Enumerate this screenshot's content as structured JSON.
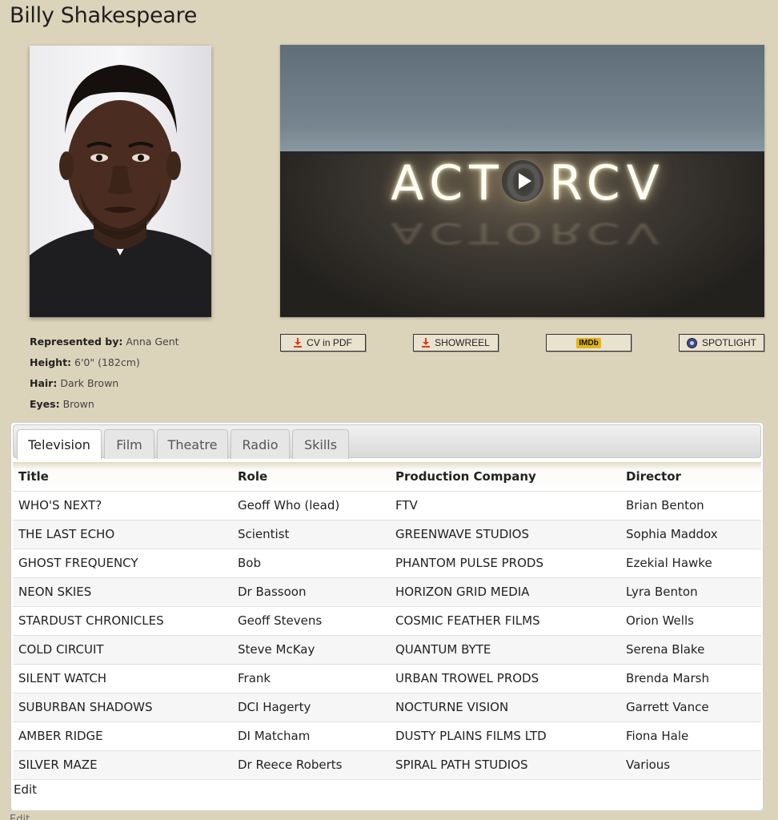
{
  "page": {
    "title": "Billy Shakespeare"
  },
  "video": {
    "logo_text": "ACTORCV"
  },
  "actions": {
    "cv_label": "CV in PDF",
    "showreel_label": "SHOWREEL",
    "imdb_label": "IMDb",
    "spotlight_label": "SPOTLIGHT"
  },
  "details": {
    "represented_label": "Represented by:",
    "represented_value": "Anna Gent",
    "height_label": "Height:",
    "height_value": "6'0\" (182cm)",
    "hair_label": "Hair:",
    "hair_value": "Dark Brown",
    "eyes_label": "Eyes:",
    "eyes_value": "Brown"
  },
  "tabs": [
    {
      "label": "Television",
      "active": true
    },
    {
      "label": "Film"
    },
    {
      "label": "Theatre"
    },
    {
      "label": "Radio"
    },
    {
      "label": "Skills"
    }
  ],
  "table": {
    "headers": [
      "Title",
      "Role",
      "Production Company",
      "Director"
    ],
    "rows": [
      [
        "WHO'S NEXT?",
        "Geoff Who (lead)",
        "FTV",
        "Brian Benton"
      ],
      [
        "THE LAST ECHO",
        "Scientist",
        "GREENWAVE STUDIOS",
        "Sophia Maddox"
      ],
      [
        "GHOST FREQUENCY",
        "Bob",
        "PHANTOM PULSE PRODS",
        "Ezekial Hawke"
      ],
      [
        "NEON SKIES",
        "Dr Bassoon",
        "HORIZON GRID MEDIA",
        "Lyra Benton"
      ],
      [
        "STARDUST CHRONICLES",
        "Geoff Stevens",
        "COSMIC FEATHER FILMS",
        "Orion Wells"
      ],
      [
        "COLD CIRCUIT",
        "Steve McKay",
        "QUANTUM BYTE",
        "Serena Blake"
      ],
      [
        "SILENT WATCH",
        "Frank",
        "URBAN TROWEL PRODS",
        "Brenda Marsh"
      ],
      [
        "SUBURBAN SHADOWS",
        "DCI Hagerty",
        "NOCTURNE VISION",
        "Garrett Vance"
      ],
      [
        "AMBER RIDGE",
        "DI Matcham",
        "DUSTY PLAINS FILMS LTD",
        "Fiona Hale"
      ],
      [
        "SILVER MAZE",
        "Dr Reece Roberts",
        "SPIRAL PATH STUDIOS",
        "Various"
      ]
    ]
  },
  "edit_label": "Edit",
  "edit_outer_label": "Edit",
  "icons": {
    "download": "download-icon",
    "imdb": "imdb-icon",
    "spotlight": "spotlight-icon",
    "play": "play-icon"
  },
  "colors": {
    "background": "#dcd3bb",
    "download_accent": "#e03a1e",
    "imdb_yellow": "#e2b616"
  }
}
